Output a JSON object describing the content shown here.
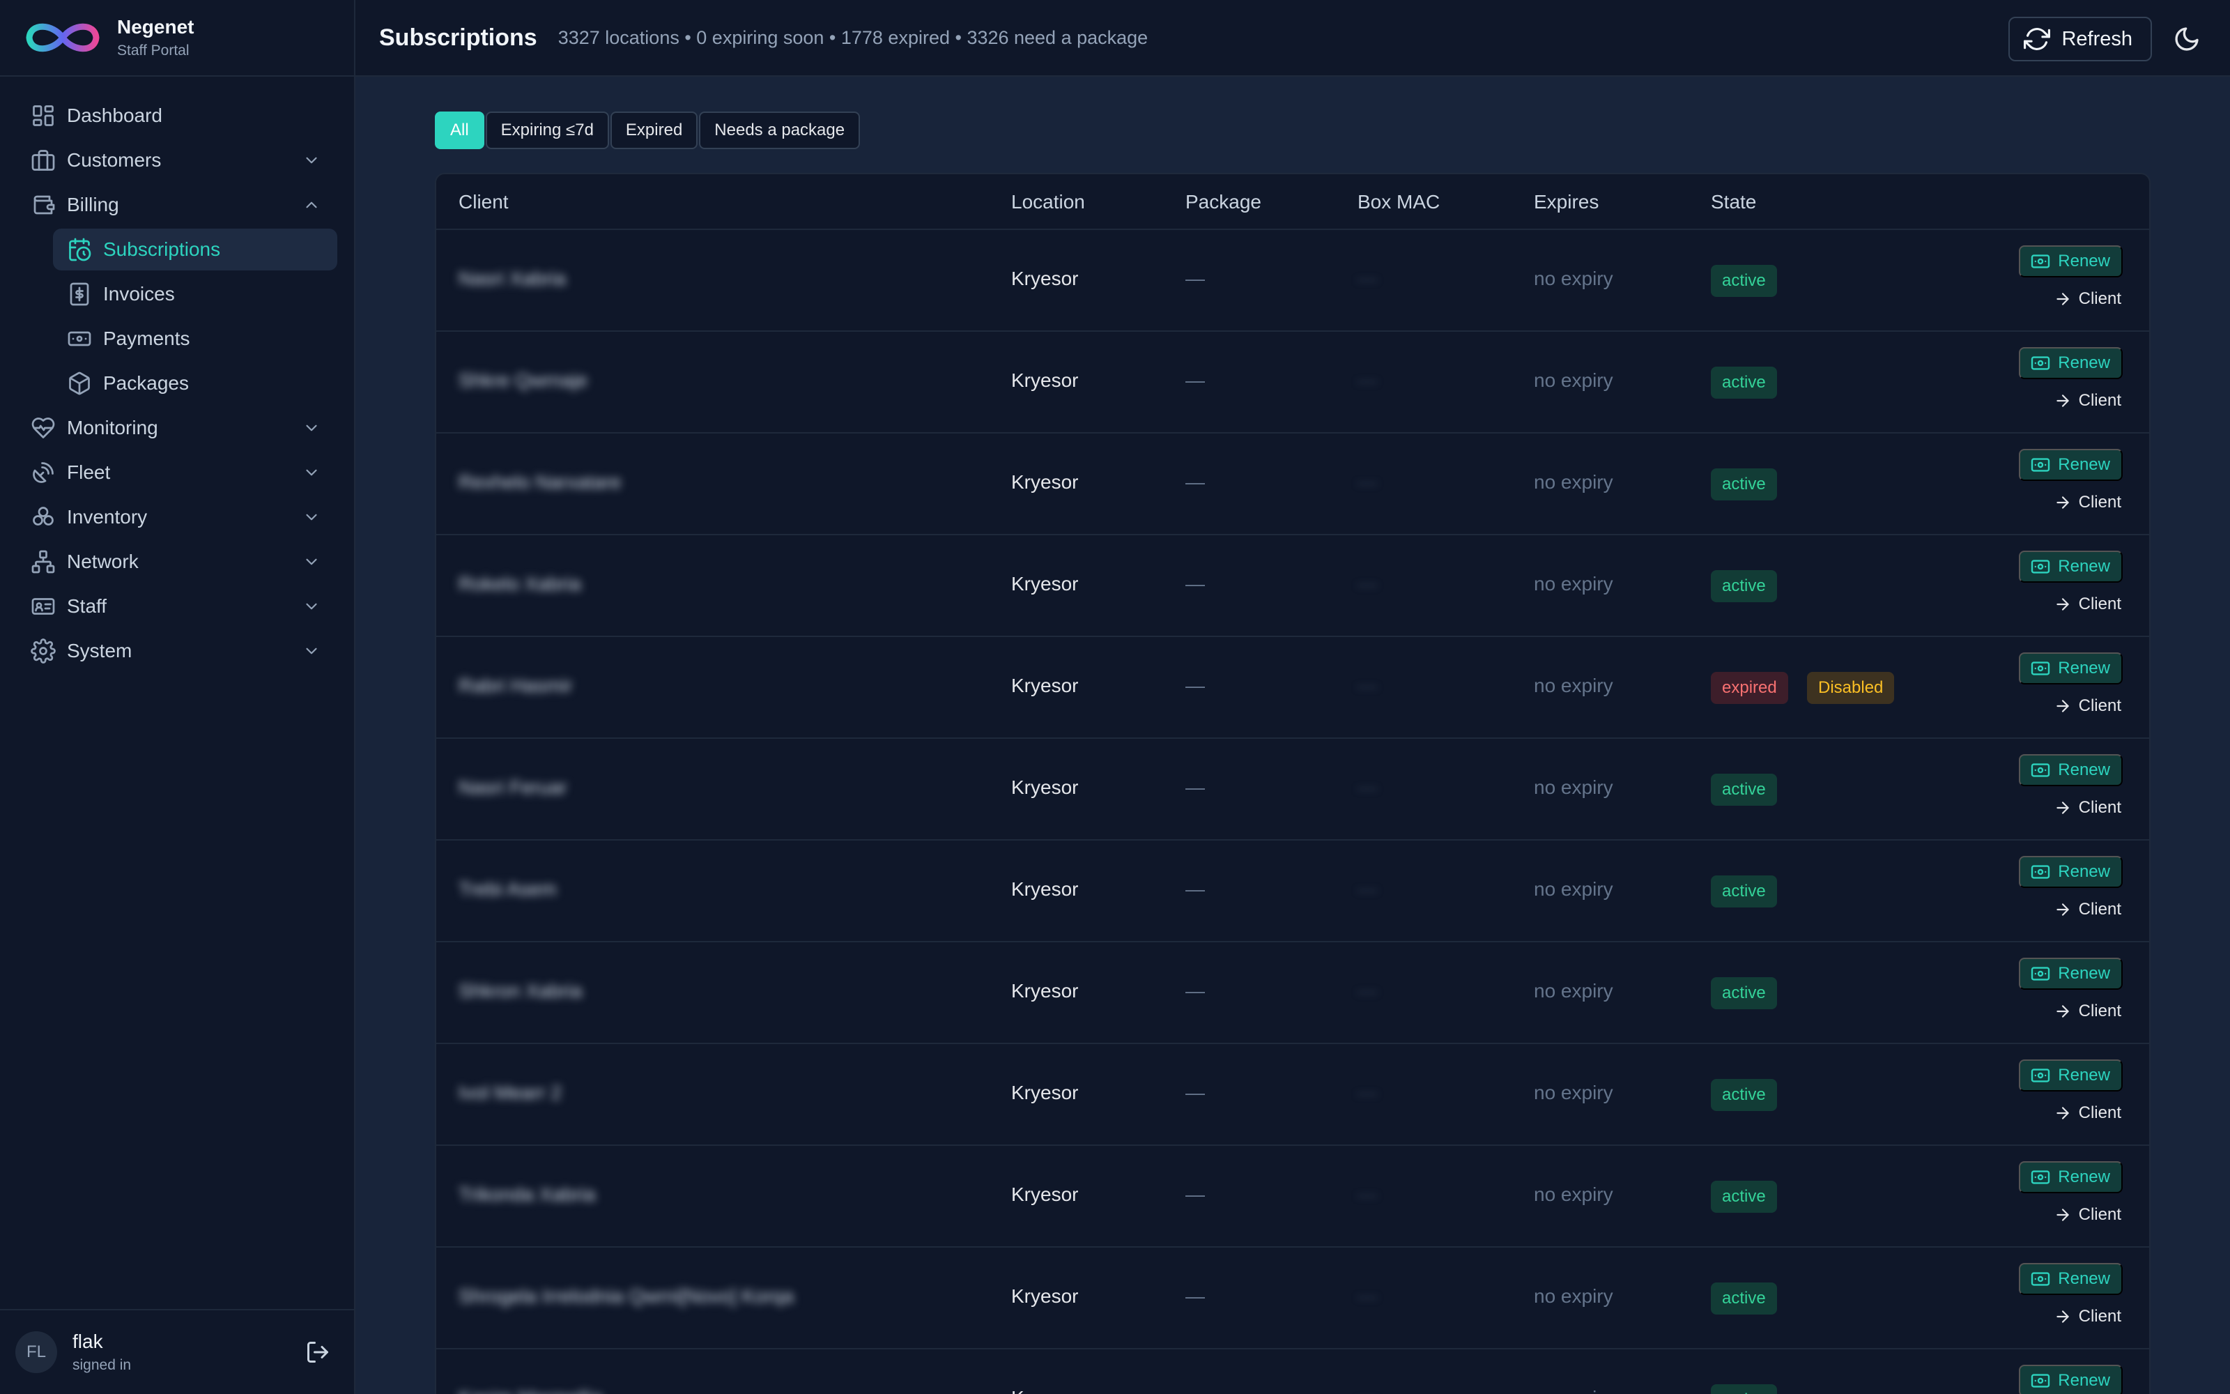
{
  "brand": {
    "name": "Negenet",
    "subtitle": "Staff Portal"
  },
  "sidebar": {
    "items": [
      {
        "label": "Dashboard",
        "icon": "dashboard-icon",
        "expandable": false
      },
      {
        "label": "Customers",
        "icon": "briefcase-icon",
        "expandable": true,
        "expanded": false
      },
      {
        "label": "Billing",
        "icon": "wallet-icon",
        "expandable": true,
        "expanded": true,
        "children": [
          {
            "label": "Subscriptions",
            "icon": "calendar-clock-icon",
            "active": true
          },
          {
            "label": "Invoices",
            "icon": "invoice-icon",
            "active": false
          },
          {
            "label": "Payments",
            "icon": "banknote-icon",
            "active": false
          },
          {
            "label": "Packages",
            "icon": "package-icon",
            "active": false
          }
        ]
      },
      {
        "label": "Monitoring",
        "icon": "heart-pulse-icon",
        "expandable": true,
        "expanded": false
      },
      {
        "label": "Fleet",
        "icon": "satellite-icon",
        "expandable": true,
        "expanded": false
      },
      {
        "label": "Inventory",
        "icon": "boxes-icon",
        "expandable": true,
        "expanded": false
      },
      {
        "label": "Network",
        "icon": "network-icon",
        "expandable": true,
        "expanded": false
      },
      {
        "label": "Staff",
        "icon": "id-card-icon",
        "expandable": true,
        "expanded": false
      },
      {
        "label": "System",
        "icon": "gear-icon",
        "expandable": true,
        "expanded": false
      }
    ]
  },
  "user": {
    "initials": "FL",
    "name": "flak",
    "status": "signed in"
  },
  "header": {
    "title": "Subscriptions",
    "summary": "3327 locations • 0 expiring soon • 1778 expired • 3326 need a package",
    "refresh_label": "Refresh"
  },
  "filters": [
    {
      "label": "All",
      "active": true
    },
    {
      "label": "Expiring ≤7d",
      "active": false
    },
    {
      "label": "Expired",
      "active": false
    },
    {
      "label": "Needs a package",
      "active": false
    }
  ],
  "table": {
    "columns": [
      "Client",
      "Location",
      "Package",
      "Box MAC",
      "Expires",
      "State"
    ],
    "renew_label": "Renew",
    "client_label": "Client",
    "rows": [
      {
        "client": "Nasri Xabria",
        "location": "Kryesor",
        "package": "—",
        "mac": "—",
        "expires": "no expiry",
        "states": [
          {
            "text": "active",
            "kind": "active"
          }
        ]
      },
      {
        "client": "Shkre Qwrnaje",
        "location": "Kryesor",
        "package": "—",
        "mac": "—",
        "expires": "no expiry",
        "states": [
          {
            "text": "active",
            "kind": "active"
          }
        ]
      },
      {
        "client": "Rexhelo Narxatare",
        "location": "Kryesor",
        "package": "—",
        "mac": "—",
        "expires": "no expiry",
        "states": [
          {
            "text": "active",
            "kind": "active"
          }
        ]
      },
      {
        "client": "Rokelo Xabria",
        "location": "Kryesor",
        "package": "—",
        "mac": "—",
        "expires": "no expiry",
        "states": [
          {
            "text": "active",
            "kind": "active"
          }
        ]
      },
      {
        "client": "Rabri Hasmir",
        "location": "Kryesor",
        "package": "—",
        "mac": "—",
        "expires": "no expiry",
        "states": [
          {
            "text": "expired",
            "kind": "expired"
          },
          {
            "text": "Disabled",
            "kind": "disabled"
          }
        ]
      },
      {
        "client": "Nasri Feruar",
        "location": "Kryesor",
        "package": "—",
        "mac": "—",
        "expires": "no expiry",
        "states": [
          {
            "text": "active",
            "kind": "active"
          }
        ]
      },
      {
        "client": "Trebi Asem",
        "location": "Kryesor",
        "package": "—",
        "mac": "—",
        "expires": "no expiry",
        "states": [
          {
            "text": "active",
            "kind": "active"
          }
        ]
      },
      {
        "client": "Shkron Xabria",
        "location": "Kryesor",
        "package": "—",
        "mac": "—",
        "expires": "no expiry",
        "states": [
          {
            "text": "active",
            "kind": "active"
          }
        ]
      },
      {
        "client": "Ivol Mearr 2",
        "location": "Kryesor",
        "package": "—",
        "mac": "—",
        "expires": "no expiry",
        "states": [
          {
            "text": "active",
            "kind": "active"
          }
        ]
      },
      {
        "client": "Trikonda Xabria",
        "location": "Kryesor",
        "package": "—",
        "mac": "—",
        "expires": "no expiry",
        "states": [
          {
            "text": "active",
            "kind": "active"
          }
        ]
      },
      {
        "client": "Shrogela Irrelodnia Qwrni[Novo] Korqa",
        "location": "Kryesor",
        "package": "—",
        "mac": "—",
        "expires": "no expiry",
        "states": [
          {
            "text": "active",
            "kind": "active"
          }
        ]
      },
      {
        "client": "Kasim Marmellia",
        "location": "Kryesor",
        "package": "—",
        "mac": "—",
        "expires": "no expiry",
        "states": [
          {
            "text": "active",
            "kind": "active"
          }
        ]
      }
    ]
  },
  "colors": {
    "accent": "#2dd4bf",
    "active_badge": "#34d399",
    "expired_badge": "#f87171",
    "disabled_badge": "#fbbf24",
    "background": "#18243a",
    "panel": "#0f1729"
  }
}
